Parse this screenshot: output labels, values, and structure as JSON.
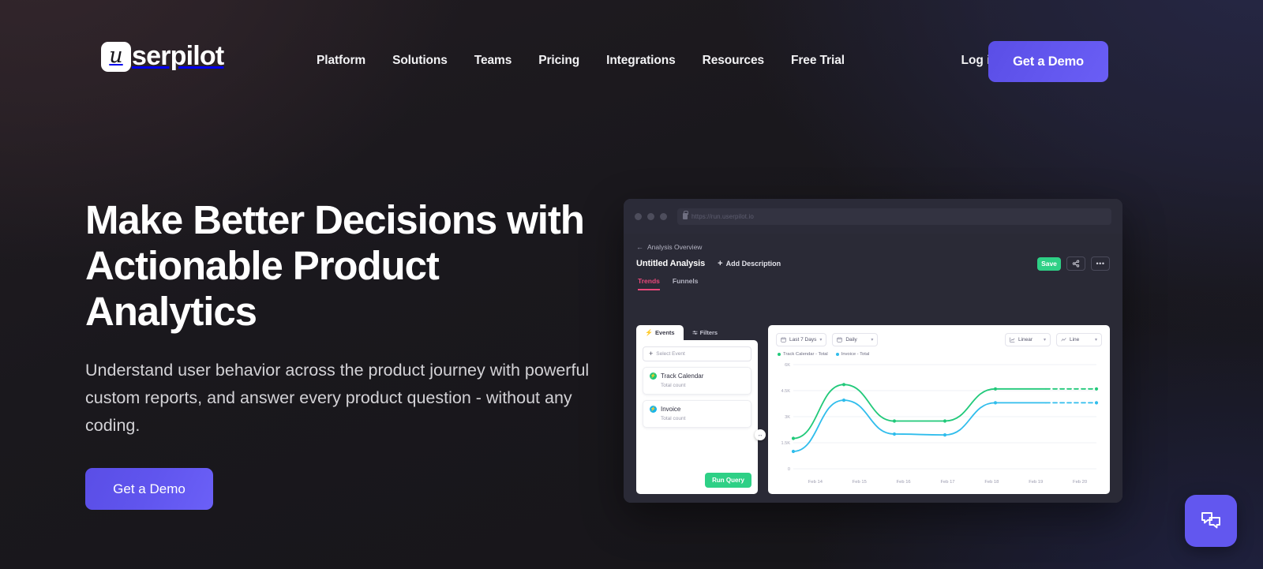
{
  "brand": {
    "logo_mark": "u",
    "logo_word": "serpilot",
    "accent_purple": "#6257ef",
    "accent_green": "#2ed086",
    "accent_pink": "#e8487a"
  },
  "nav": {
    "links": [
      {
        "label": "Platform"
      },
      {
        "label": "Solutions"
      },
      {
        "label": "Teams"
      },
      {
        "label": "Pricing"
      },
      {
        "label": "Integrations"
      },
      {
        "label": "Resources"
      },
      {
        "label": "Free Trial"
      }
    ],
    "login_label": "Log in",
    "cta_label": "Get a Demo"
  },
  "hero": {
    "headline": "Make Better Decisions with Actionable Product Analytics",
    "subhead": "Understand user behavior across the product journey with powerful custom reports, and answer every product question - without any coding.",
    "cta_label": "Get a Demo"
  },
  "mockup": {
    "browser": {
      "url": "https://run.userpilot.io"
    },
    "breadcrumb": "Analysis Overview",
    "title": "Untitled Analysis",
    "add_description": "Add Description",
    "save_label": "Save",
    "more_label": "•••",
    "tabs": [
      {
        "label": "Trends",
        "active": true
      },
      {
        "label": "Funnels",
        "active": false
      }
    ],
    "events_panel": {
      "tabs": [
        {
          "label": "Events",
          "active": true
        },
        {
          "label": "Filters",
          "active": false
        }
      ],
      "select_event_label": "Select Event",
      "events": [
        {
          "name": "Track Calendar",
          "metric": "Total count",
          "color": "#21c97a"
        },
        {
          "name": "Invoice",
          "metric": "Total count",
          "color": "#19b5e8"
        }
      ],
      "run_query_label": "Run Query"
    },
    "chart_controls": [
      {
        "name": "date-range",
        "value": "Last 7 Days",
        "icon": "calendar-icon"
      },
      {
        "name": "granularity",
        "value": "Daily",
        "icon": "calendar-icon"
      },
      {
        "name": "scale",
        "value": "Linear",
        "icon": "axis-icon"
      },
      {
        "name": "chart-type",
        "value": "Line",
        "icon": "line-chart-icon"
      }
    ]
  },
  "chart_data": {
    "type": "line",
    "title": "",
    "xlabel": "",
    "ylabel": "",
    "categories": [
      "Feb 14",
      "Feb 15",
      "Feb 16",
      "Feb 17",
      "Feb 18",
      "Feb 19",
      "Feb 20"
    ],
    "x_tick_labels": [
      "Feb 14",
      "Feb 15",
      "Feb 16",
      "Feb 17",
      "Feb 18",
      "Feb 19",
      "Feb 20"
    ],
    "y_tick_labels": [
      "0",
      "1.5K",
      "3K",
      "4.5K",
      "6K"
    ],
    "y_ticks": [
      0,
      1500,
      3000,
      4500,
      6000
    ],
    "ylim": [
      0,
      6000
    ],
    "grid": true,
    "legend_position": "top-left",
    "series": [
      {
        "name": "Track Calendar - Total",
        "color": "#21c97a",
        "values": [
          1750,
          4850,
          2750,
          2750,
          4600,
          4600,
          4600
        ],
        "dashed_from_index": 5
      },
      {
        "name": "Invoice - Total",
        "color": "#30bdec",
        "values": [
          1000,
          3950,
          2000,
          1950,
          3800,
          3800,
          3800
        ],
        "dashed_from_index": 5
      }
    ]
  },
  "chat": {
    "label": "chat",
    "color": "#6257ef"
  }
}
